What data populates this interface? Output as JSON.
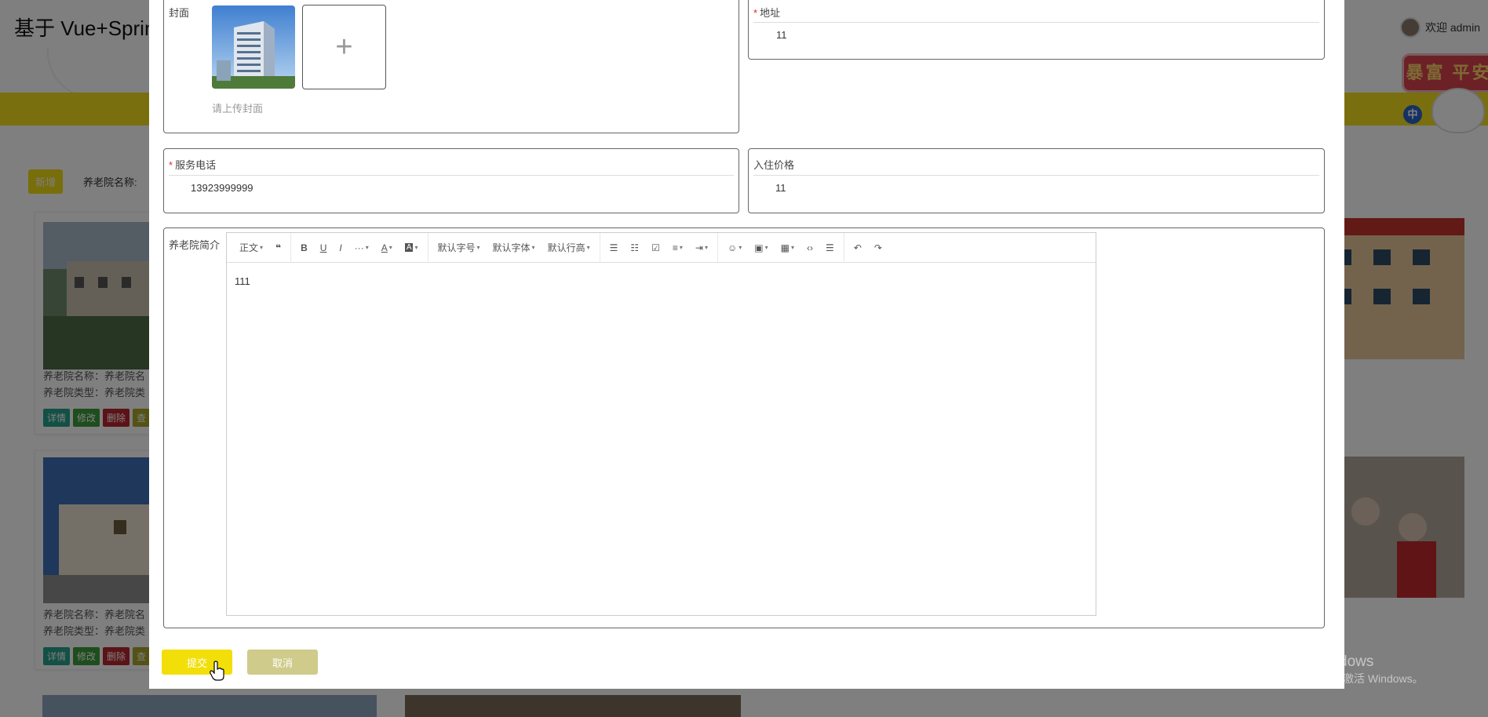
{
  "background": {
    "app_title": "基于 Vue+Sprin",
    "welcome": "欢迎 admin",
    "add_button": "新增",
    "search_label": "养老院名称:",
    "cards": [
      {
        "name_line": "养老院名称：养老院名",
        "type_line": "养老院类型：养老院类"
      },
      {
        "name_line": "养老院名称：养老院名",
        "type_line": "养老院类型：养老院类"
      }
    ],
    "card_buttons": [
      "详情",
      "修改",
      "删除",
      "查"
    ],
    "sticker_text": "暴富 平安",
    "sticker_badge": "中",
    "watermark_line1": "激活 Windows",
    "watermark_line2": "转到\"设置\"以激活 Windows。"
  },
  "form": {
    "cover": {
      "label": "封面",
      "hint": "请上传封面",
      "upload_plus": "+"
    },
    "address": {
      "required_mark": "*",
      "label": "地址",
      "value": "11"
    },
    "phone": {
      "required_mark": "*",
      "label": "服务电话",
      "value": "13923999999"
    },
    "price": {
      "label": "入住价格",
      "value": "11"
    },
    "intro": {
      "label": "养老院简介",
      "content": "111"
    }
  },
  "editor_toolbar": {
    "heading": "正文",
    "quote": "❝",
    "bold": "B",
    "underline": "U",
    "italic": "I",
    "more": "···",
    "font_color": "A",
    "bg_color": "A",
    "font_size": "默认字号",
    "font_family": "默认字体",
    "line_height": "默认行高",
    "bullet_list": "☰",
    "numbered_list": "☷",
    "todo": "☑",
    "align": "≡",
    "indent": "⇥",
    "emoji": "☺",
    "image": "▣",
    "table": "▦",
    "code": "‹›",
    "divider": "☰",
    "undo": "↶",
    "redo": "↷"
  },
  "actions": {
    "submit": "提交",
    "cancel": "取消"
  }
}
